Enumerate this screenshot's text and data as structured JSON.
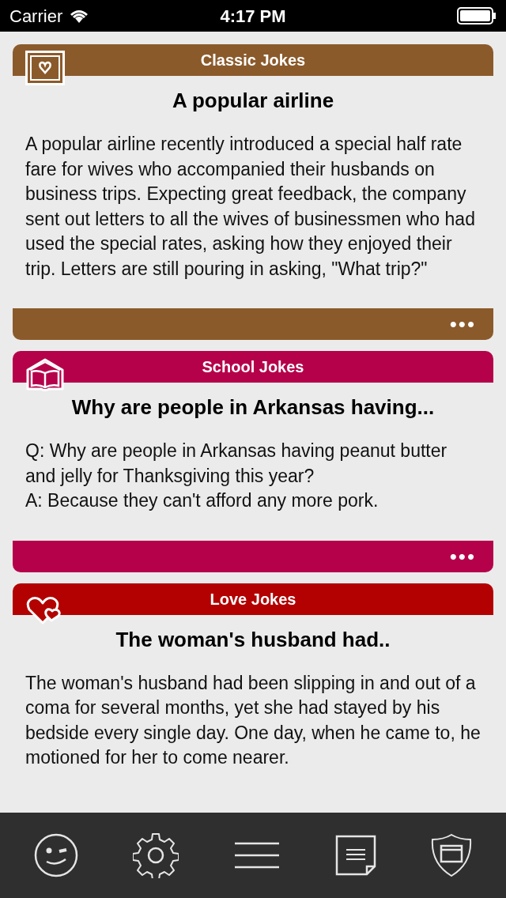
{
  "status_bar": {
    "carrier": "Carrier",
    "time": "4:17 PM"
  },
  "cards": [
    {
      "kind": "frame-heart",
      "category": "Classic Jokes",
      "color": "#8b5a2b",
      "title": "A popular airline",
      "body": [
        "A popular airline recently introduced a special half rate fare for wives who accompanied their husbands on business trips. Expecting great feedback, the company sent out letters to all the wives of businessmen who had used the special rates, asking how they enjoyed their trip. Letters are still pouring in asking, \"What trip?\""
      ],
      "footer": true,
      "more": "•••"
    },
    {
      "kind": "school",
      "category": "School Jokes",
      "color": "#b5004a",
      "title": "Why are people in Arkansas having...",
      "body": [
        "Q: Why are people in Arkansas having peanut butter and jelly for Thanksgiving this year?",
        "A: Because they can't afford any more pork."
      ],
      "footer": true,
      "more": "•••"
    },
    {
      "kind": "hearts",
      "category": "Love Jokes",
      "color": "#b30000",
      "title": "The woman's husband had..",
      "body": [
        "The woman's husband had been slipping in and out of a coma for several months, yet she had stayed by his bedside every single day. One day, when he came to, he motioned for her to come nearer."
      ]
    }
  ],
  "tab_bar": [
    {
      "kind": "wink"
    },
    {
      "kind": "gear"
    },
    {
      "kind": "menu"
    },
    {
      "kind": "note"
    },
    {
      "kind": "shield"
    }
  ]
}
